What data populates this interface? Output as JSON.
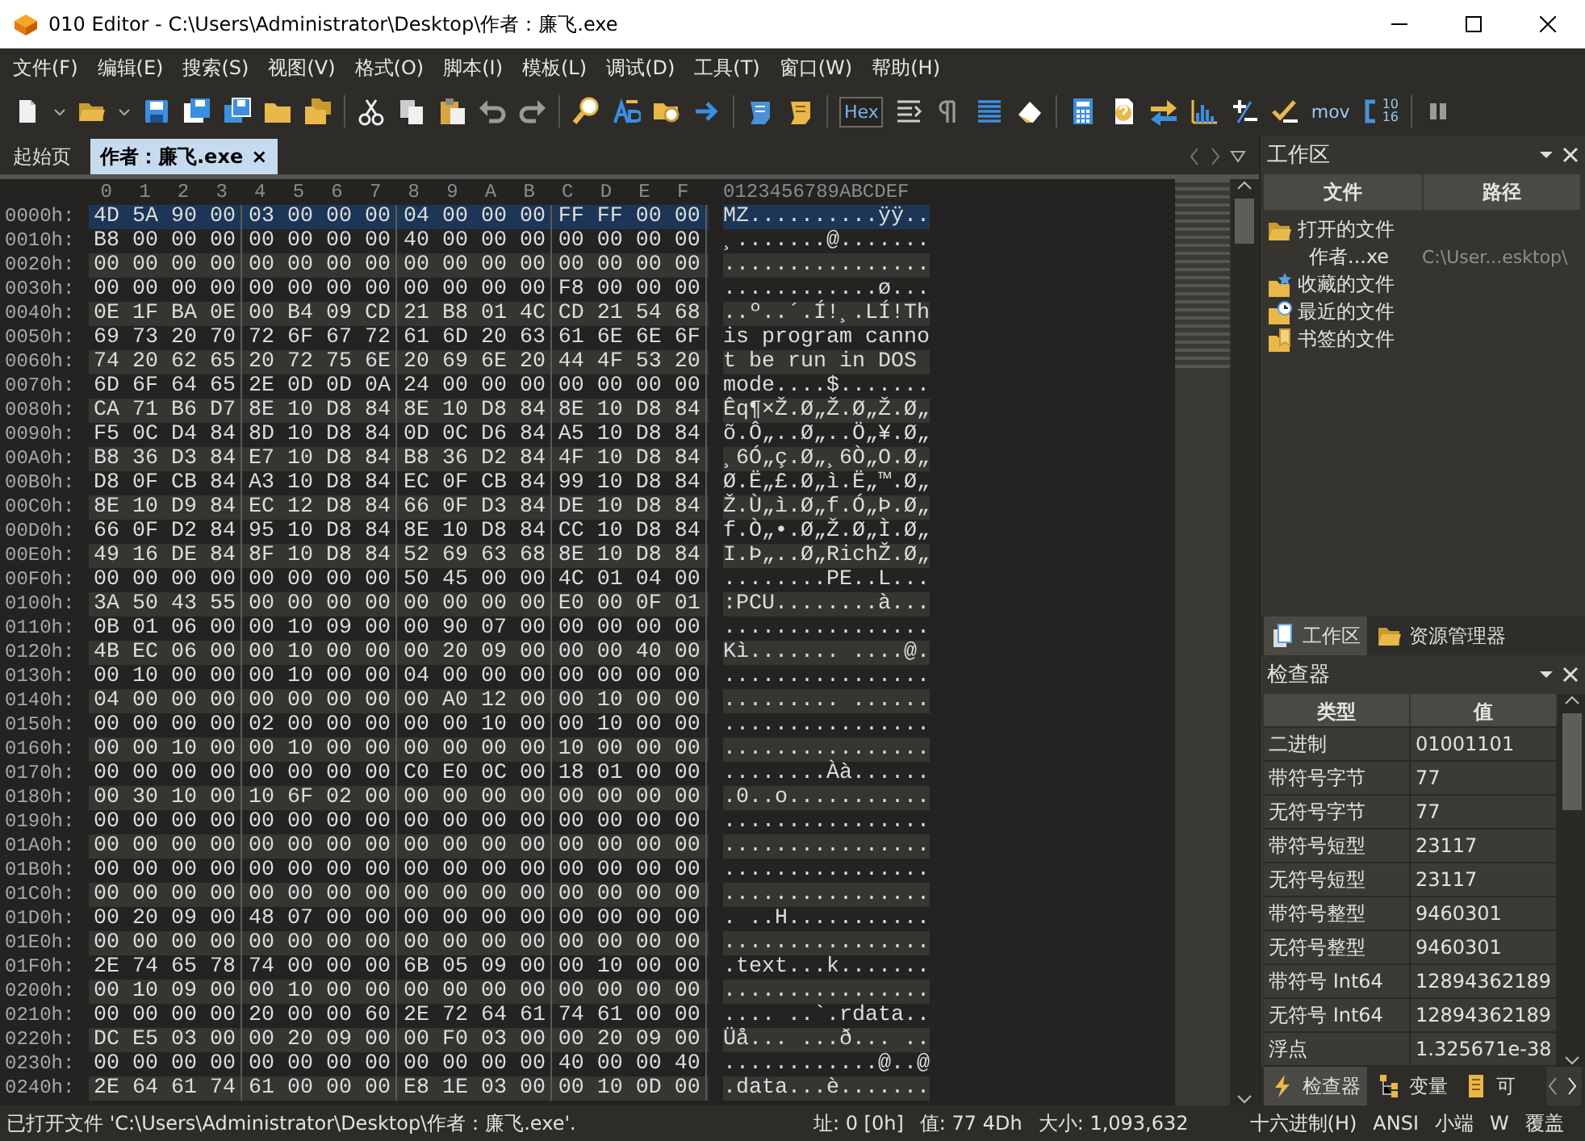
{
  "window": {
    "title": "010 Editor - C:\\Users\\Administrator\\Desktop\\作者：廉飞.exe"
  },
  "menu": [
    "文件(F)",
    "编辑(E)",
    "搜索(S)",
    "视图(V)",
    "格式(O)",
    "脚本(I)",
    "模板(L)",
    "调试(D)",
    "工具(T)",
    "窗口(W)",
    "帮助(H)"
  ],
  "toolbar": {
    "hex_label": "Hex",
    "hex_selected": true,
    "mov_label": "mov",
    "base_labels": [
      "10",
      "16"
    ]
  },
  "tabs": [
    {
      "label": "起始页",
      "selected": false
    },
    {
      "label": "作者：廉飞.exe",
      "selected": true,
      "close": "×"
    }
  ],
  "editor": {
    "columns": [
      "0",
      "1",
      "2",
      "3",
      "4",
      "5",
      "6",
      "7",
      "8",
      "9",
      "A",
      "B",
      "C",
      "D",
      "E",
      "F"
    ],
    "ascii_header": "0123456789ABCDEF",
    "rows": [
      {
        "address": "0000h:",
        "hex": "4D 5A 90 00 03 00 00 00 04 00 00 00 FF FF 00 00",
        "ascii": "MZ..........ÿÿ..",
        "selected": true
      },
      {
        "address": "0010h:",
        "hex": "B8 00 00 00 00 00 00 00 40 00 00 00 00 00 00 00",
        "ascii": "¸.......@.......",
        "selected": false
      },
      {
        "address": "0020h:",
        "hex": "00 00 00 00 00 00 00 00 00 00 00 00 00 00 00 00",
        "ascii": "................",
        "selected": false
      },
      {
        "address": "0030h:",
        "hex": "00 00 00 00 00 00 00 00 00 00 00 00 F8 00 00 00",
        "ascii": "............ø...",
        "selected": false
      },
      {
        "address": "0040h:",
        "hex": "0E 1F BA 0E 00 B4 09 CD 21 B8 01 4C CD 21 54 68",
        "ascii": "..º..´.Í!¸.LÍ!Th",
        "selected": false
      },
      {
        "address": "0050h:",
        "hex": "69 73 20 70 72 6F 67 72 61 6D 20 63 61 6E 6E 6F",
        "ascii": "is program canno",
        "selected": false
      },
      {
        "address": "0060h:",
        "hex": "74 20 62 65 20 72 75 6E 20 69 6E 20 44 4F 53 20",
        "ascii": "t be run in DOS ",
        "selected": false
      },
      {
        "address": "0070h:",
        "hex": "6D 6F 64 65 2E 0D 0D 0A 24 00 00 00 00 00 00 00",
        "ascii": "mode....$.......",
        "selected": false
      },
      {
        "address": "0080h:",
        "hex": "CA 71 B6 D7 8E 10 D8 84 8E 10 D8 84 8E 10 D8 84",
        "ascii": "Êq¶×Ž.Ø„Ž.Ø„Ž.Ø„",
        "selected": false
      },
      {
        "address": "0090h:",
        "hex": "F5 0C D4 84 8D 10 D8 84 0D 0C D6 84 A5 10 D8 84",
        "ascii": "õ.Ô„..Ø„..Ö„¥.Ø„",
        "selected": false
      },
      {
        "address": "00A0h:",
        "hex": "B8 36 D3 84 E7 10 D8 84 B8 36 D2 84 4F 10 D8 84",
        "ascii": "¸6Ó„ç.Ø„¸6Ò„O.Ø„",
        "selected": false
      },
      {
        "address": "00B0h:",
        "hex": "D8 0F CB 84 A3 10 D8 84 EC 0F CB 84 99 10 D8 84",
        "ascii": "Ø.Ë„£.Ø„ì.Ë„™.Ø„",
        "selected": false
      },
      {
        "address": "00C0h:",
        "hex": "8E 10 D9 84 EC 12 D8 84 66 0F D3 84 DE 10 D8 84",
        "ascii": "Ž.Ù„ì.Ø„f.Ó„Þ.Ø„",
        "selected": false
      },
      {
        "address": "00D0h:",
        "hex": "66 0F D2 84 95 10 D8 84 8E 10 D8 84 CC 10 D8 84",
        "ascii": "f.Ò„•.Ø„Ž.Ø„Ì.Ø„",
        "selected": false
      },
      {
        "address": "00E0h:",
        "hex": "49 16 DE 84 8F 10 D8 84 52 69 63 68 8E 10 D8 84",
        "ascii": "I.Þ„..Ø„RichŽ.Ø„",
        "selected": false
      },
      {
        "address": "00F0h:",
        "hex": "00 00 00 00 00 00 00 00 50 45 00 00 4C 01 04 00",
        "ascii": "........PE..L...",
        "selected": false
      },
      {
        "address": "0100h:",
        "hex": "3A 50 43 55 00 00 00 00 00 00 00 00 E0 00 0F 01",
        "ascii": ":PCU........à...",
        "selected": false
      },
      {
        "address": "0110h:",
        "hex": "0B 01 06 00 00 10 09 00 00 90 07 00 00 00 00 00",
        "ascii": "................",
        "selected": false
      },
      {
        "address": "0120h:",
        "hex": "4B EC 06 00 00 10 00 00 00 20 09 00 00 00 40 00",
        "ascii": "Kì....... ....@.",
        "selected": false
      },
      {
        "address": "0130h:",
        "hex": "00 10 00 00 00 10 00 00 04 00 00 00 00 00 00 00",
        "ascii": "................",
        "selected": false
      },
      {
        "address": "0140h:",
        "hex": "04 00 00 00 00 00 00 00 00 A0 12 00 00 10 00 00",
        "ascii": "......... ......",
        "selected": false
      },
      {
        "address": "0150h:",
        "hex": "00 00 00 00 02 00 00 00 00 00 10 00 00 10 00 00",
        "ascii": "................",
        "selected": false
      },
      {
        "address": "0160h:",
        "hex": "00 00 10 00 00 10 00 00 00 00 00 00 10 00 00 00",
        "ascii": "................",
        "selected": false
      },
      {
        "address": "0170h:",
        "hex": "00 00 00 00 00 00 00 00 C0 E0 0C 00 18 01 00 00",
        "ascii": "........Àà......",
        "selected": false
      },
      {
        "address": "0180h:",
        "hex": "00 30 10 00 10 6F 02 00 00 00 00 00 00 00 00 00",
        "ascii": ".0..o...........",
        "selected": false
      },
      {
        "address": "0190h:",
        "hex": "00 00 00 00 00 00 00 00 00 00 00 00 00 00 00 00",
        "ascii": "................",
        "selected": false
      },
      {
        "address": "01A0h:",
        "hex": "00 00 00 00 00 00 00 00 00 00 00 00 00 00 00 00",
        "ascii": "................",
        "selected": false
      },
      {
        "address": "01B0h:",
        "hex": "00 00 00 00 00 00 00 00 00 00 00 00 00 00 00 00",
        "ascii": "................",
        "selected": false
      },
      {
        "address": "01C0h:",
        "hex": "00 00 00 00 00 00 00 00 00 00 00 00 00 00 00 00",
        "ascii": "................",
        "selected": false
      },
      {
        "address": "01D0h:",
        "hex": "00 20 09 00 48 07 00 00 00 00 00 00 00 00 00 00",
        "ascii": ". ..H...........",
        "selected": false
      },
      {
        "address": "01E0h:",
        "hex": "00 00 00 00 00 00 00 00 00 00 00 00 00 00 00 00",
        "ascii": "................",
        "selected": false
      },
      {
        "address": "01F0h:",
        "hex": "2E 74 65 78 74 00 00 00 6B 05 09 00 00 10 00 00",
        "ascii": ".text...k.......",
        "selected": false
      },
      {
        "address": "0200h:",
        "hex": "00 10 09 00 00 10 00 00 00 00 00 00 00 00 00 00",
        "ascii": "................",
        "selected": false
      },
      {
        "address": "0210h:",
        "hex": "00 00 00 00 20 00 00 60 2E 72 64 61 74 61 00 00",
        "ascii": ".... ..`.rdata..",
        "selected": false
      },
      {
        "address": "0220h:",
        "hex": "DC E5 03 00 00 20 09 00 00 F0 03 00 00 20 09 00",
        "ascii": "Üå... ...ð... ..",
        "selected": false
      },
      {
        "address": "0230h:",
        "hex": "00 00 00 00 00 00 00 00 00 00 00 00 40 00 00 40",
        "ascii": "............@..@",
        "selected": false
      },
      {
        "address": "0240h:",
        "hex": "2E 64 61 74 61 00 00 00 E8 1E 03 00 00 10 0D 00",
        "ascii": ".data...è.......",
        "selected": false
      }
    ]
  },
  "workspace": {
    "title": "工作区",
    "columns": [
      "文件",
      "路径"
    ],
    "tree": [
      {
        "label": "打开的文件",
        "kind": "open",
        "children": [
          {
            "label": "作者...xe",
            "path": "C:\\User...esktop\\"
          }
        ]
      },
      {
        "label": "收藏的文件",
        "kind": "favorites"
      },
      {
        "label": "最近的文件",
        "kind": "recent"
      },
      {
        "label": "书签的文件",
        "kind": "bookmarks"
      }
    ],
    "tabs": [
      {
        "label": "工作区",
        "kind": "workspace",
        "selected": true
      },
      {
        "label": "资源管理器",
        "kind": "explorer",
        "selected": false
      }
    ]
  },
  "inspector": {
    "title": "检查器",
    "columns": [
      "类型",
      "值"
    ],
    "rows": [
      {
        "type": "二进制",
        "value": "01001101"
      },
      {
        "type": "带符号字节",
        "value": "77"
      },
      {
        "type": "无符号字节",
        "value": "77"
      },
      {
        "type": "带符号短型",
        "value": "23117"
      },
      {
        "type": "无符号短型",
        "value": "23117"
      },
      {
        "type": "带符号整型",
        "value": "9460301"
      },
      {
        "type": "无符号整型",
        "value": "9460301"
      },
      {
        "type": "带符号 Int64",
        "value": "12894362189"
      },
      {
        "type": "无符号 Int64",
        "value": "12894362189"
      },
      {
        "type": "浮点",
        "value": "1.325671e-38"
      }
    ],
    "tabs": [
      {
        "label": "检查器",
        "kind": "inspector",
        "selected": true
      },
      {
        "label": "变量",
        "kind": "variables",
        "selected": false
      },
      {
        "label": "可",
        "kind": "document",
        "selected": false
      }
    ]
  },
  "status_bar": {
    "message": "已打开文件 'C:\\Users\\Administrator\\Desktop\\作者：廉飞.exe'.",
    "address": "址: 0 [0h]",
    "value": "值: 77 4Dh",
    "size": "大小: 1,093,632",
    "format": "十六进制(H)",
    "encoding": "ANSI",
    "endian": "小端",
    "insert_key": "W",
    "mode": "覆盖"
  }
}
